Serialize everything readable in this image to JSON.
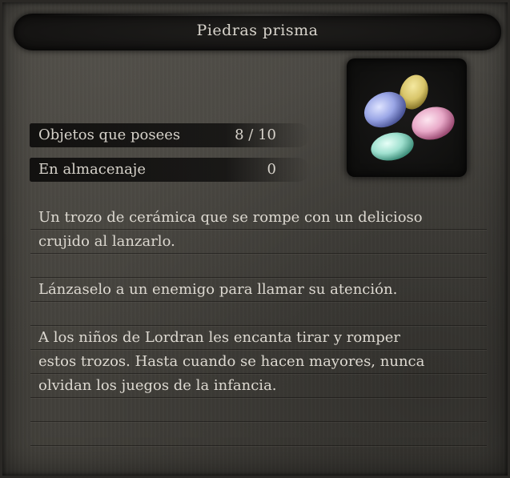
{
  "item": {
    "title": "Piedras prisma",
    "icon": "prism-stones-icon"
  },
  "stats": [
    {
      "label": "Objetos que posees",
      "value": "8 / 10"
    },
    {
      "label": "En almacenaje",
      "value": "0"
    }
  ],
  "description": {
    "lines": [
      "Un trozo de cerámica que se rompe con un delicioso",
      "crujido al lanzarlo.",
      "",
      "Lánzaselo a un enemigo para llamar su atención.",
      "",
      "A los niños de Lordran les encanta tirar y romper",
      "estos trozos. Hasta cuando se hacen mayores, nunca",
      "olvidan los juegos de la infancia.",
      "",
      ""
    ]
  },
  "colors": {
    "stone_yellow": "#d8c56a",
    "stone_blue": "#9aa6e6",
    "stone_pink": "#e8a9c8",
    "stone_green": "#9fe0cf"
  }
}
